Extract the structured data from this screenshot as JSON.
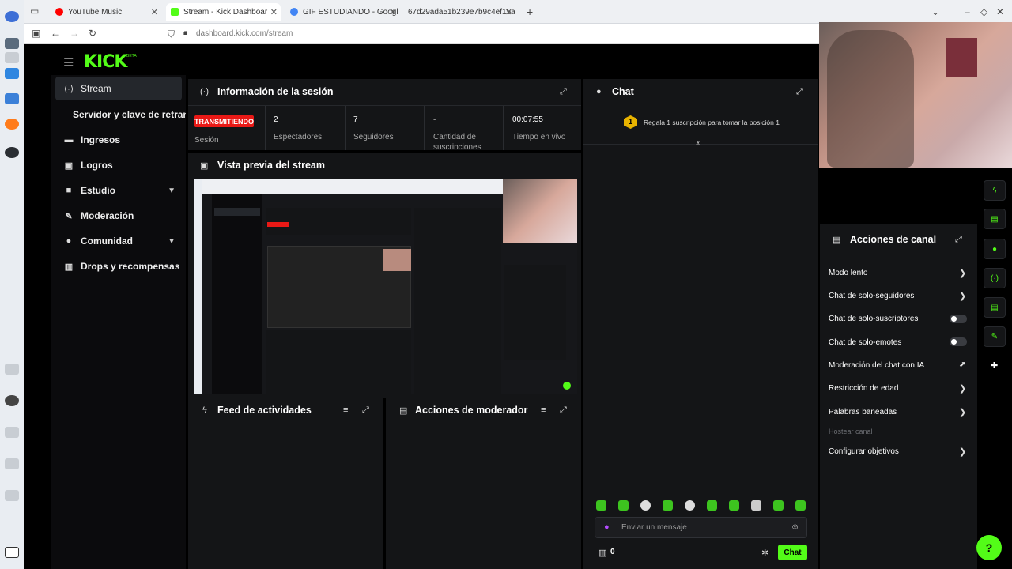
{
  "browser": {
    "tabs": [
      {
        "label": "YouTube Music",
        "color": "#ff0000"
      },
      {
        "label": "Stream - Kick Dashboar",
        "color": "#53fc18"
      },
      {
        "label": "GIF ESTUDIANDO - Googl",
        "color": "#4285f4"
      },
      {
        "label": "67d29ada51b239e7b9c4ef15a",
        "color": "#888888"
      }
    ],
    "url": "dashboard.kick.com/stream"
  },
  "brand": {
    "logo": "KICK",
    "beta": "BETA",
    "accent": "#53fc18",
    "live_red": "#e91916"
  },
  "sidebar": {
    "items": [
      {
        "label": "Stream",
        "icon": "broadcast-icon"
      },
      {
        "label": "Servidor y clave de retransm",
        "icon": ""
      },
      {
        "label": "Ingresos",
        "icon": "money-icon"
      },
      {
        "label": "Logros",
        "icon": "trophy-icon"
      },
      {
        "label": "Estudio",
        "icon": "camera-icon"
      },
      {
        "label": "Moderación",
        "icon": "wrench-icon"
      },
      {
        "label": "Comunidad",
        "icon": "users-icon"
      },
      {
        "label": "Drops y recompensas",
        "icon": "gift-icon"
      }
    ]
  },
  "session": {
    "title": "Información de la sesión",
    "status": "TRANSMITIENDO",
    "status_label": "Sesión",
    "stats": [
      {
        "value": "2",
        "label": "Espectadores"
      },
      {
        "value": "7",
        "label": "Seguidores"
      },
      {
        "value": "-",
        "label": "Cantidad de suscripciones"
      },
      {
        "value": "00:07:55",
        "label": "Tiempo en vivo"
      }
    ]
  },
  "preview": {
    "title": "Vista previa del stream"
  },
  "activity": {
    "title": "Feed de actividades"
  },
  "mod_actions": {
    "title": "Acciones de moderador"
  },
  "chat": {
    "title": "Chat",
    "pinned_rank": "1",
    "pinned": "Regala 1 suscripción para tomar la posición 1",
    "placeholder": "Enviar un mensaje",
    "count": "0",
    "send_label": "Chat"
  },
  "channel_actions": {
    "title": "Acciones de canal",
    "items": [
      {
        "label": "Modo lento",
        "control": "chevron"
      },
      {
        "label": "Chat de solo-seguidores",
        "control": "chevron"
      },
      {
        "label": "Chat de solo-suscriptores",
        "control": "toggle"
      },
      {
        "label": "Chat de solo-emotes",
        "control": "toggle"
      },
      {
        "label": "Moderación del chat con IA",
        "control": "external"
      },
      {
        "label": "Restricción de edad",
        "control": "chevron"
      },
      {
        "label": "Palabras baneadas",
        "control": "chevron"
      },
      {
        "label": "Hostear canal",
        "control": "disabled"
      },
      {
        "label": "Configurar objetivos",
        "control": "chevron"
      }
    ]
  }
}
